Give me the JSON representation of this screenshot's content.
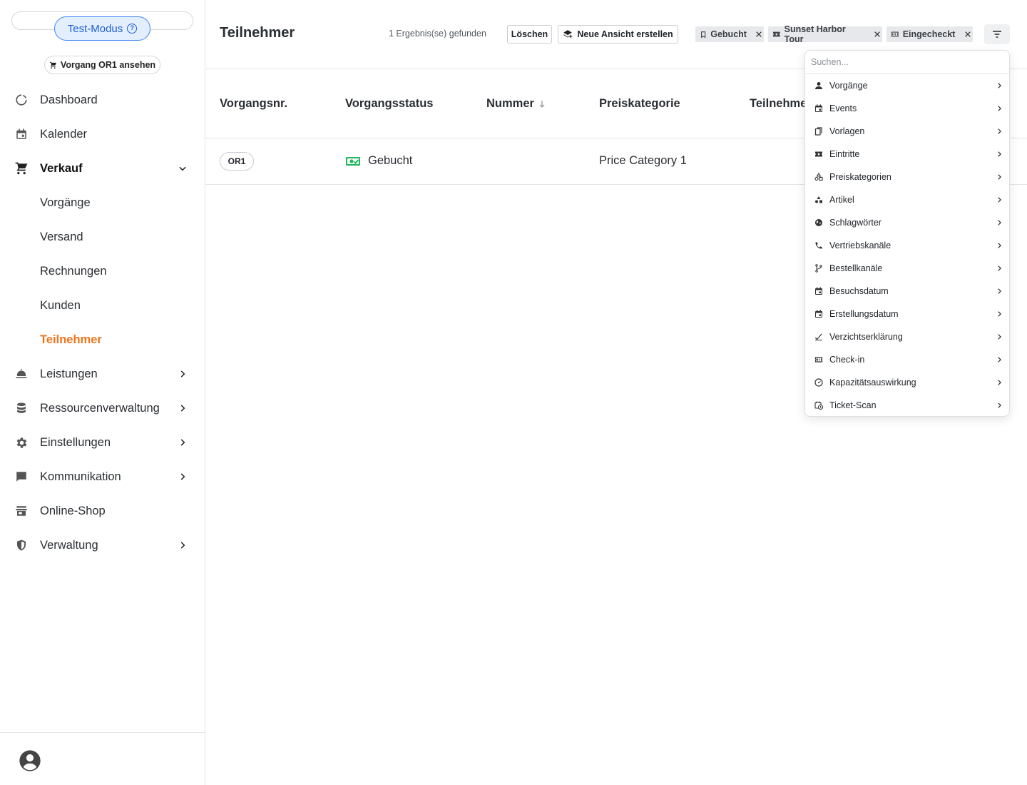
{
  "sidebar": {
    "test_mode_label": "Test-Modus",
    "order_chip_label": "Vorgang OR1 ansehen",
    "items": [
      {
        "label": "Dashboard",
        "icon": "dashboard-icon"
      },
      {
        "label": "Kalender",
        "icon": "calendar-icon"
      },
      {
        "label": "Verkauf",
        "icon": "cart-icon",
        "expanded": true
      },
      {
        "label": "Leistungen",
        "icon": "service-bell-icon"
      },
      {
        "label": "Ressourcenverwaltung",
        "icon": "database-icon"
      },
      {
        "label": "Einstellungen",
        "icon": "gear-icon"
      },
      {
        "label": "Kommunikation",
        "icon": "chat-icon"
      },
      {
        "label": "Online-Shop",
        "icon": "store-icon"
      },
      {
        "label": "Verwaltung",
        "icon": "shield-icon"
      }
    ],
    "sub_items": [
      "Vorgänge",
      "Versand",
      "Rechnungen",
      "Kunden",
      "Teilnehmer"
    ],
    "active_sub_item": "Teilnehmer"
  },
  "header": {
    "title": "Teilnehmer",
    "result_count": "1 Ergebnis(se) gefunden",
    "clear_label": "Löschen",
    "new_view_label": "Neue Ansicht erstellen",
    "filters": [
      {
        "label": "Gebucht",
        "icon": "bookmark-icon"
      },
      {
        "label": "Sunset Harbor Tour",
        "icon": "ticket-icon"
      },
      {
        "label": "Eingecheckt",
        "icon": "ticket-outline-icon"
      }
    ]
  },
  "table": {
    "columns": [
      "Vorgangsnr.",
      "Vorgangsstatus",
      "Nummer",
      "Preiskategorie",
      "Teilnehmer"
    ],
    "rows": [
      {
        "order_no": "OR1",
        "status": "Gebucht",
        "number": "",
        "price_category": "Price Category 1"
      }
    ]
  },
  "filter_menu": {
    "search_placeholder": "Suchen...",
    "items": [
      {
        "label": "Vorgänge",
        "icon": "person-icon"
      },
      {
        "label": "Events",
        "icon": "event-icon"
      },
      {
        "label": "Vorlagen",
        "icon": "copy-icon"
      },
      {
        "label": "Eintritte",
        "icon": "ticket-icon"
      },
      {
        "label": "Preiskategorien",
        "icon": "category-icon"
      },
      {
        "label": "Artikel",
        "icon": "shapes-icon"
      },
      {
        "label": "Schlagwörter",
        "icon": "globe-icon"
      },
      {
        "label": "Vertriebskanäle",
        "icon": "phone-icon"
      },
      {
        "label": "Bestellkanäle",
        "icon": "fork-icon"
      },
      {
        "label": "Besuchsdatum",
        "icon": "event-icon"
      },
      {
        "label": "Erstellungsdatum",
        "icon": "event-icon"
      },
      {
        "label": "Verzichtserklärung",
        "icon": "signature-icon"
      },
      {
        "label": "Check-in",
        "icon": "ticket-outline-icon"
      },
      {
        "label": "Kapazitätsauswirkung",
        "icon": "gauge-icon"
      },
      {
        "label": "Ticket-Scan",
        "icon": "calendar-clock-icon"
      }
    ]
  },
  "colors": {
    "accent_orange": "#f0731c",
    "test_mode_blue": "#1d5fd1",
    "booked_green": "#1fb85a"
  }
}
